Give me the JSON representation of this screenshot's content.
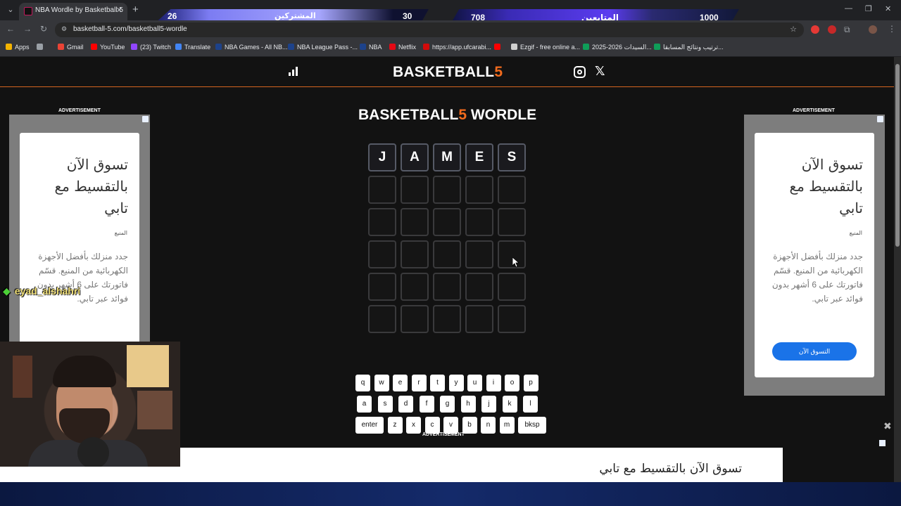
{
  "browser": {
    "tab_title": "NBA Wordle by Basketball 5",
    "url": "basketball-5.com/basketball5-wordle",
    "bookmarks": [
      "Apps",
      "Gmail",
      "YouTube",
      "(23) Twitch",
      "Translate",
      "NBA Games - All NB...",
      "NBA League Pass -...",
      "NBA",
      "Netflix",
      "https://app.ufcarabi...",
      "",
      "Ezgif - free online a...",
      "السيدات 2026-2025...",
      "ترتيب ونتائج المسابقا..."
    ]
  },
  "overlay": {
    "subs_label": "المشتركين",
    "subs_current": "26",
    "subs_goal": "30",
    "followers_label": "المتابعين",
    "followers_current": "708",
    "followers_goal": "1000"
  },
  "site": {
    "logo_main": "BASKETBALL",
    "logo_accent": "5",
    "game_title_main": "BASKETBALL",
    "game_title_accent": "5",
    "game_title_suffix": " WORDLE"
  },
  "board": {
    "rows": [
      [
        "J",
        "A",
        "M",
        "E",
        "S"
      ],
      [
        "",
        "",
        "",
        "",
        ""
      ],
      [
        "",
        "",
        "",
        "",
        ""
      ],
      [
        "",
        "",
        "",
        "",
        ""
      ],
      [
        "",
        "",
        "",
        "",
        ""
      ],
      [
        "",
        "",
        "",
        "",
        ""
      ]
    ]
  },
  "keyboard": {
    "row1": [
      "q",
      "w",
      "e",
      "r",
      "t",
      "y",
      "u",
      "i",
      "o",
      "p"
    ],
    "row2": [
      "a",
      "s",
      "d",
      "f",
      "g",
      "h",
      "j",
      "k",
      "l"
    ],
    "row3": [
      "enter",
      "z",
      "x",
      "c",
      "v",
      "b",
      "n",
      "m",
      "bksp"
    ]
  },
  "ads": {
    "label": "ADVERTISEMENT",
    "headline": "تسوق الآن بالتقسيط مع تابي",
    "source": "المنيع",
    "body": "جدد منزلك بأفضل الأجهزة الكهربائية من المنيع. قسّم فاتورتك على 6 أشهر بدون فوائد عبر تابي.",
    "button": "التسوق الآن",
    "bottom_label": "ADVERTISEMENT",
    "bottom_headline": "تسوق الآن بالتقسيط مع تابي"
  },
  "chat": {
    "username": "eyad_alshahri"
  }
}
